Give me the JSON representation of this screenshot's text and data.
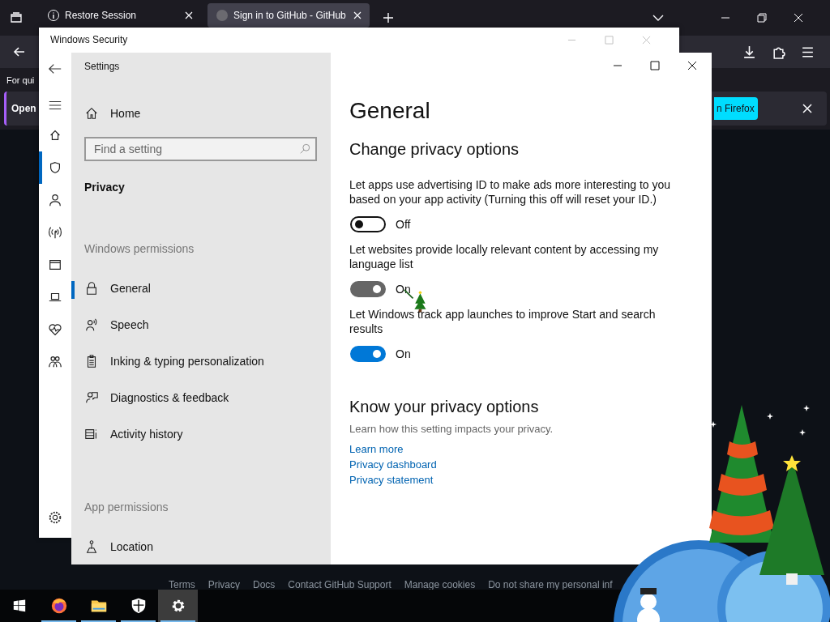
{
  "browser": {
    "tabs": [
      {
        "title": "Restore Session",
        "selected": false
      },
      {
        "title": "Sign in to GitHub - GitHub",
        "selected": true
      }
    ],
    "page_text": "For qui",
    "notification": {
      "text": "Open",
      "button": "n Firefox"
    },
    "footer_links": [
      "Terms",
      "Privacy",
      "Docs",
      "Contact GitHub Support",
      "Manage cookies",
      "Do not share my personal inf"
    ]
  },
  "security_window": {
    "title": "Windows Security",
    "nav_items": [
      {
        "selected": false
      },
      {
        "selected": true
      },
      {
        "selected": false
      },
      {
        "selected": false
      },
      {
        "selected": false
      },
      {
        "selected": false
      },
      {
        "selected": false
      },
      {
        "selected": false
      }
    ]
  },
  "settings": {
    "title": "Settings",
    "home": "Home",
    "search_placeholder": "Find a setting",
    "section": "Privacy",
    "groups": [
      {
        "heading": "Windows permissions",
        "items": [
          {
            "label": "General",
            "selected": true
          },
          {
            "label": "Speech",
            "selected": false
          },
          {
            "label": "Inking & typing personalization",
            "selected": false
          },
          {
            "label": "Diagnostics & feedback",
            "selected": false
          },
          {
            "label": "Activity history",
            "selected": false
          }
        ]
      },
      {
        "heading": "App permissions",
        "items": [
          {
            "label": "Location",
            "selected": false
          }
        ]
      }
    ],
    "page_title": "General",
    "heading": "Change privacy options",
    "options": [
      {
        "text": "Let apps use advertising ID to make ads more interesting to you based on your app activity (Turning this off will reset your ID.)",
        "on": false,
        "pressed": false,
        "state_label": "Off"
      },
      {
        "text": "Let websites provide locally relevant content by accessing my language list",
        "on": true,
        "pressed": true,
        "state_label": "On"
      },
      {
        "text": "Let Windows track app launches to improve Start and search results",
        "on": true,
        "pressed": false,
        "state_label": "On"
      }
    ],
    "know_heading": "Know your privacy options",
    "know_text": "Learn how this setting impacts your privacy.",
    "links": [
      "Learn more",
      "Privacy dashboard",
      "Privacy statement"
    ]
  },
  "taskbar": {
    "apps": [
      {
        "running": true,
        "selected": false
      },
      {
        "running": true,
        "selected": false
      },
      {
        "running": true,
        "selected": false
      },
      {
        "running": true,
        "selected": true
      }
    ]
  }
}
